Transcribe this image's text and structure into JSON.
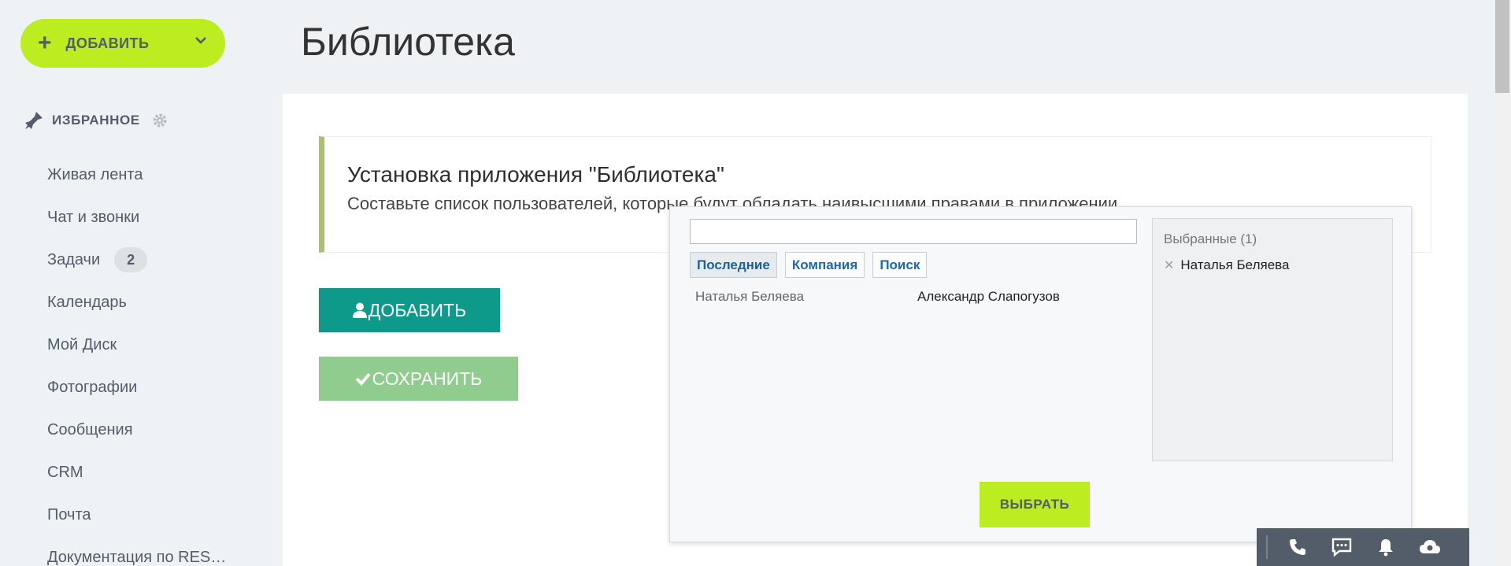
{
  "sidebar": {
    "add_button": "ДОБАВИТЬ",
    "favorites_label": "ИЗБРАННОЕ",
    "items": [
      {
        "label": "Живая лента"
      },
      {
        "label": "Чат и звонки"
      },
      {
        "label": "Задачи",
        "badge": "2"
      },
      {
        "label": "Календарь"
      },
      {
        "label": "Мой Диск"
      },
      {
        "label": "Фотографии"
      },
      {
        "label": "Сообщения"
      },
      {
        "label": "CRM"
      },
      {
        "label": "Почта"
      },
      {
        "label": "Документация по RES…"
      }
    ]
  },
  "page": {
    "title": "Библиотека",
    "alert_title": "Установка приложения \"Библиотека\"",
    "alert_text": "Составьте список пользователей, которые будут обладать наивысшими правами в приложении",
    "add_button": "ДОБАВИТЬ",
    "save_button": "СОХРАНИТЬ"
  },
  "popup": {
    "search_value": "",
    "tabs": [
      "Последние",
      "Компания",
      "Поиск"
    ],
    "active_tab": "Последние",
    "users": [
      "Наталья Беляева",
      "Александр Слапогузов"
    ],
    "selected_header": "Выбранные (1)",
    "selected": [
      "Наталья Беляева"
    ],
    "choose_button": "ВЫБРАТЬ"
  },
  "colors": {
    "accent_green": "#bbed21",
    "teal_button": "#0d9a8b",
    "save_button": "#8fcc8d",
    "toolbar": "#535c69"
  },
  "toolbar_icons": [
    "phone-icon",
    "chat-icon",
    "bell-icon",
    "cloud-icon"
  ]
}
